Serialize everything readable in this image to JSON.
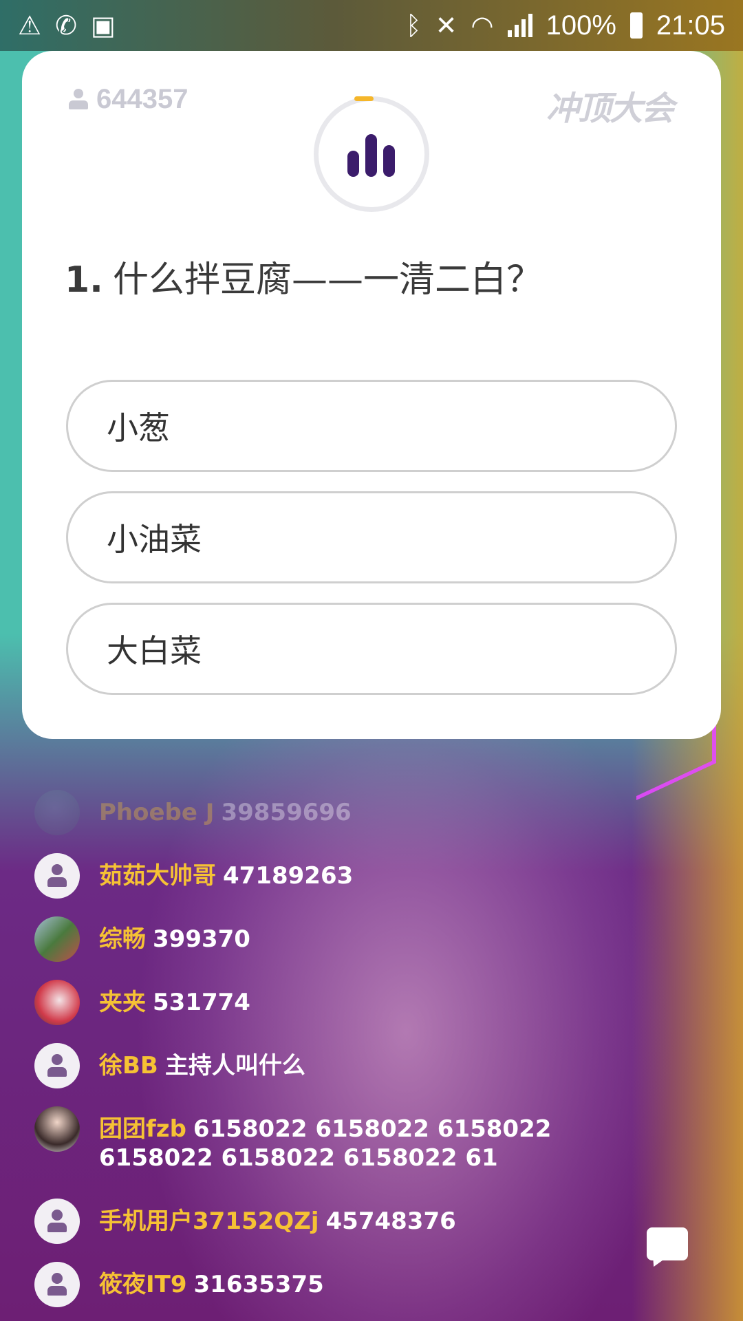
{
  "status_bar": {
    "battery": "100%",
    "time": "21:05",
    "icons": [
      "warning-icon",
      "wifi-call-icon",
      "screen-record-icon",
      "bluetooth-icon",
      "mute-vibrate-icon",
      "wifi-icon",
      "signal-icon",
      "battery-icon"
    ]
  },
  "card": {
    "viewer_count": "644357",
    "logo_text": "冲顶大会",
    "question_number": "1.",
    "question_text": "什么拌豆腐——一清二白？",
    "options": [
      {
        "label": "小葱"
      },
      {
        "label": "小油菜"
      },
      {
        "label": "大白菜"
      }
    ],
    "colors": {
      "timer_accent": "#f5b62a",
      "bars": "#3b1c6b"
    }
  },
  "chat": {
    "messages": [
      {
        "nick": "Phoebe J",
        "text": "39859696"
      },
      {
        "nick": "茹茹大帅哥",
        "text": "47189263"
      },
      {
        "nick": "综畅",
        "text": "399370"
      },
      {
        "nick": "夹夹",
        "text": "531774"
      },
      {
        "nick": "徐BB",
        "text": "主持人叫什么"
      },
      {
        "nick": "团团fzb",
        "text": "6158022 6158022 6158022 6158022 6158022 6158022 61"
      },
      {
        "nick": "手机用户37152QZj",
        "text": "45748376"
      },
      {
        "nick": "筱夜IT9",
        "text": "31635375"
      }
    ],
    "nick_color": "#f6c234"
  }
}
